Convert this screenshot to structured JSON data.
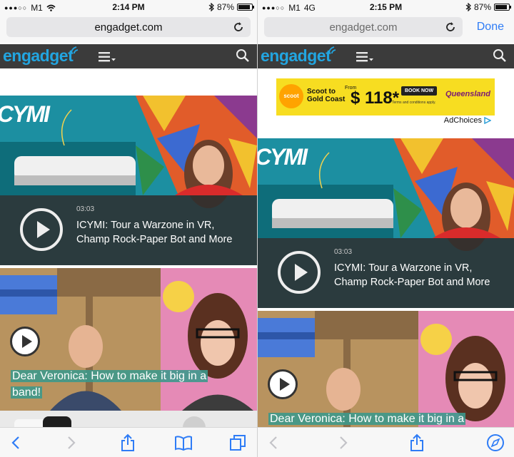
{
  "screens": [
    {
      "status": {
        "carrier": "M1",
        "network": "",
        "time": "2:14 PM",
        "battery": "87%",
        "battery_level": 0.87
      },
      "url": "engadget.com",
      "logo": "engadget",
      "card1": {
        "duration": "03:03",
        "title": "ICYMI: Tour a Warzone in VR, Champ Rock-Paper Bot and More"
      },
      "card2": {
        "title": "Dear Veronica: How to make it big in a band!"
      }
    },
    {
      "status": {
        "carrier": "M1",
        "network": "4G",
        "time": "2:15 PM",
        "battery": "87%",
        "battery_level": 0.87
      },
      "url": "engadget.com",
      "done_label": "Done",
      "logo": "engadget",
      "ad": {
        "brand": "scoot",
        "headline": "Scoot to Gold Coast",
        "from": "From",
        "price": "$ 118*",
        "cta": "BOOK NOW",
        "terms": "*Terms and conditions apply.",
        "partner": "Queensland",
        "adchoices": "AdChoices"
      },
      "card1": {
        "duration": "03:03",
        "title": "ICYMI: Tour a Warzone in VR, Champ Rock-Paper Bot and More"
      },
      "card2": {
        "title": "Dear Veronica: How to make it big in a"
      }
    }
  ],
  "cymi_label": "CYMI",
  "icons": [
    "wifi-icon",
    "bluetooth-icon",
    "battery-icon",
    "reload-icon",
    "menu-icon",
    "search-icon",
    "back-icon",
    "forward-icon",
    "share-icon",
    "bookmarks-icon",
    "tabs-icon",
    "compass-icon"
  ],
  "colors": {
    "accent": "#2e7cf6",
    "logo": "#22a5e0",
    "navbar": "#3b3b3b",
    "ad_bg": "#f7dd21",
    "title_highlight": "#3a988c"
  }
}
